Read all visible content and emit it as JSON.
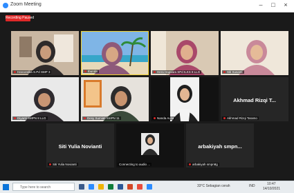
{
  "window": {
    "title": "Zoom Meeting",
    "min_glyph": "–",
    "max_glyph": "□",
    "close_glyph": "×"
  },
  "recording_badge": "Recording Paused",
  "participants": [
    {
      "id": "p1",
      "name": "Hanaratika S.Pd SMP 3",
      "muted": true
    },
    {
      "id": "p2",
      "name": "Ibunda",
      "muted": true,
      "active_speaker": true
    },
    {
      "id": "p3",
      "name": "Hera Hapsara SPd ILKS 8 LLG",
      "muted": true
    },
    {
      "id": "p4",
      "name": "Siti Susanti",
      "muted": true
    },
    {
      "id": "p5",
      "name": "Diyanti SMPN 8 LLG",
      "muted": true
    },
    {
      "id": "p6",
      "name": "Desy Sumiati SmPN 11",
      "muted": true
    },
    {
      "id": "p7",
      "name": "Nanda Aulia",
      "muted": true
    },
    {
      "id": "p8",
      "name": "Akhmad Rizqi Taramo",
      "display": "Akhmad Rizqi T...",
      "muted": true
    },
    {
      "id": "p9",
      "name": "Siti Yulia Novianti",
      "display": "Siti Yulia Novianti",
      "muted": true
    },
    {
      "id": "p10",
      "name": "Connecting to audio ...",
      "muted": false
    },
    {
      "id": "p11",
      "name": "arbakiyah smpn8g",
      "display": "arbakiyah smpn...",
      "muted": true
    }
  ],
  "taskbar": {
    "search_placeholder": "Type here to search",
    "weather": "33°C  Sebagian cerah",
    "lang": "IND",
    "time": "10:47",
    "date": "14/10/2021"
  },
  "colors": {
    "accent": "#2d8cff",
    "recording": "#e02828",
    "active_border": "#f2d230"
  }
}
